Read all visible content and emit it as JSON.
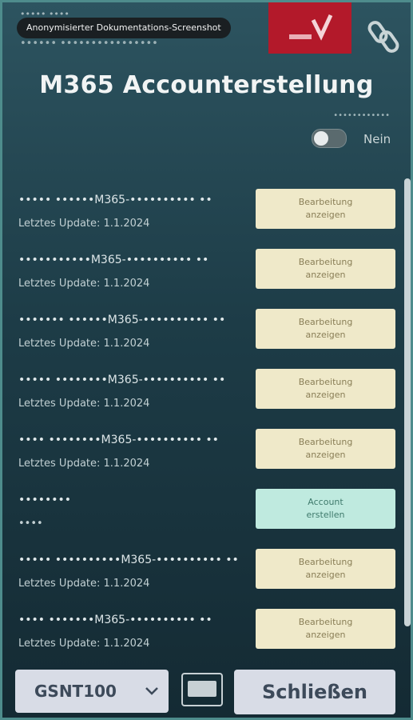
{
  "header": {
    "badge": "Anonymisierter Dokumentations-Screenshot",
    "app_line1": "••••• ••••",
    "app_line2": "•••••• ••••••••••••••••",
    "title": "M365 Accounterstellung",
    "toggle_label": "••••••••••••",
    "toggle_state": "Nein"
  },
  "colors": {
    "logo": "#b3192a",
    "action_pending": "#efe9c9",
    "action_ready": "#bfeadf",
    "button_bg": "#d8dce6"
  },
  "rows": [
    {
      "name": "••••• ••••••M365-•••••••••• ••",
      "meta": "Letztes Update: 1.1.2024",
      "action": "Bearbeitung\nanzeigen",
      "state": "pending"
    },
    {
      "name": "•••••••••••M365-•••••••••• ••",
      "meta": "Letztes Update: 1.1.2024",
      "action": "Bearbeitung\nanzeigen",
      "state": "pending"
    },
    {
      "name": "••••••• ••••••M365-•••••••••• ••",
      "meta": "Letztes Update: 1.1.2024",
      "action": "Bearbeitung\nanzeigen",
      "state": "pending"
    },
    {
      "name": "••••• ••••••••M365-•••••••••• ••",
      "meta": "Letztes Update: 1.1.2024",
      "action": "Bearbeitung\nanzeigen",
      "state": "pending"
    },
    {
      "name": "•••• ••••••••M365-•••••••••• ••",
      "meta": "Letztes Update: 1.1.2024",
      "action": "Bearbeitung\nanzeigen",
      "state": "pending"
    },
    {
      "name": "••••••••",
      "meta": "••••",
      "action": "Account\nerstellen",
      "state": "ready"
    },
    {
      "name": "••••• ••••••••••M365-•••••••••• ••",
      "meta": "Letztes Update: 1.1.2024",
      "action": "Bearbeitung\nanzeigen",
      "state": "pending"
    },
    {
      "name": "•••• •••••••M365-•••••••••• ••",
      "meta": "Letztes Update: 1.1.2024",
      "action": "Bearbeitung\nanzeigen",
      "state": "pending"
    }
  ],
  "footer": {
    "select_value": "GSNT100",
    "close_label": "Schließen"
  },
  "icons": [
    "logo-icon",
    "link-icon",
    "chevron-down-icon",
    "keyboard-icon"
  ]
}
